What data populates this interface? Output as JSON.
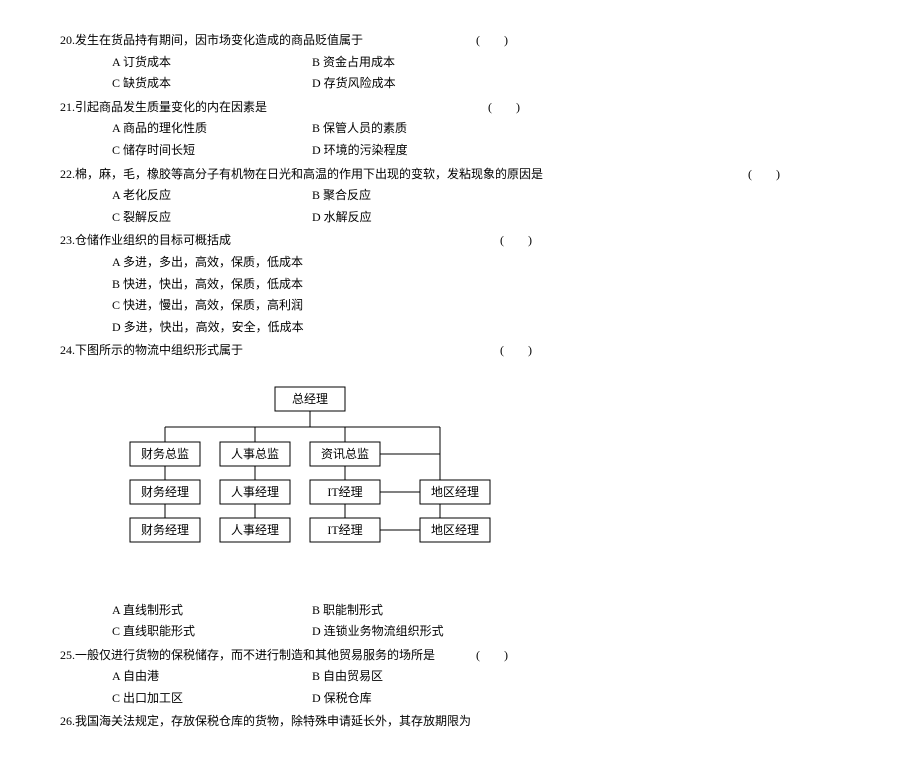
{
  "q20": {
    "num": "20.",
    "text": "发生在货品持有期间，因市场变化造成的商品贬值属于",
    "paren": "(　　)",
    "a": "A 订货成本",
    "b": "B 资金占用成本",
    "c": "C 缺货成本",
    "d": "D 存货风险成本"
  },
  "q21": {
    "num": "21.",
    "text": "引起商品发生质量变化的内在因素是",
    "paren": "(　　)",
    "a": "A 商品的理化性质",
    "b": "B 保管人员的素质",
    "c": "C 储存时间长短",
    "d": "D 环境的污染程度"
  },
  "q22": {
    "num": "22.",
    "text": "棉，麻，毛，橡胶等高分子有机物在日光和高温的作用下出现的变软，发粘现象的原因是",
    "paren": "(　　)",
    "a": "A 老化反应",
    "b": "B 聚合反应",
    "c": "C 裂解反应",
    "d": "D 水解反应"
  },
  "q23": {
    "num": "23.",
    "text": "仓储作业组织的目标可概括成",
    "paren": "(　　)",
    "a": "A 多进，多出，高效，保质，低成本",
    "b": "B 快进，快出，高效，保质，低成本",
    "c": "C 快进，慢出，高效，保质，高利润",
    "d": "D 多进，快出，高效，安全，低成本"
  },
  "q24": {
    "num": "24.",
    "text": "下图所示的物流中组织形式属于",
    "paren": "(　　)",
    "a": "A 直线制形式",
    "b": "B 职能制形式",
    "c": "C 直线职能形式",
    "d": "D 连锁业务物流组织形式"
  },
  "q25": {
    "num": "25.",
    "text": "一般仅进行货物的保税储存，而不进行制造和其他贸易服务的场所是",
    "paren": "(　　)",
    "a": "A 自由港",
    "b": "B 自由贸易区",
    "c": "C 出口加工区",
    "d": "D 保税仓库"
  },
  "q26": {
    "num": "26.",
    "text": "我国海关法规定，存放保税仓库的货物，除特殊申请延长外，其存放期限为"
  },
  "org": {
    "top": "总经理",
    "c1r1": "财务总监",
    "c1r2": "财务经理",
    "c1r3": "财务经理",
    "c2r1": "人事总监",
    "c2r2": "人事经理",
    "c2r3": "人事经理",
    "c3r1": "资讯总监",
    "c3r2": "IT经理",
    "c3r3": "IT经理",
    "c4r2": "地区经理",
    "c4r3": "地区经理"
  }
}
